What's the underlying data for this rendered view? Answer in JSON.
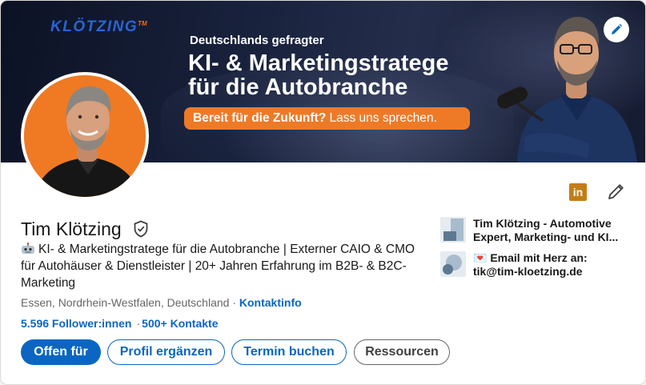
{
  "banner": {
    "brand": "KLÖTZING",
    "brand_tm": "TM",
    "subtitle": "Deutschlands gefragter",
    "title_line1": "KI- & Marketingstratege",
    "title_line2": "für die Autobranche",
    "cta_bold": "Bereit für die Zukunft?",
    "cta_rest": " Lass uns sprechen.",
    "accent_color": "#ee7a26"
  },
  "profile": {
    "name": "Tim Klötzing",
    "headline": "KI- & Marketingstratege für die Autobranche | Externer CAIO & CMO für Autohäuser & Dienstleister | 20+ Jahren Erfahrung im B2B- & B2C-Marketing",
    "location": "Essen, Nordrhein-Westfalen, Deutschland",
    "location_separator": "·",
    "contact_link": "Kontaktinfo",
    "followers": "5.596 Follower:innen",
    "stats_separator": "·",
    "connections": "500+ Kontakte",
    "linkedin_badge": "in"
  },
  "sidebar": {
    "items": [
      {
        "line1": "Tim Klötzing - Automotive",
        "line2": "Expert, Marketing- und KI..."
      },
      {
        "line1": "Email mit Herz an:",
        "line2": "tik@tim-kloetzing.de",
        "emoji": "💌"
      }
    ]
  },
  "actions": {
    "open_to": "Offen für",
    "add_section": "Profil ergänzen",
    "book_appointment": "Termin buchen",
    "resources": "Ressourcen"
  },
  "colors": {
    "primary": "#0a66c2",
    "avatar_bg": "#ef7a23",
    "linkedin_badge": "#c37d16"
  }
}
